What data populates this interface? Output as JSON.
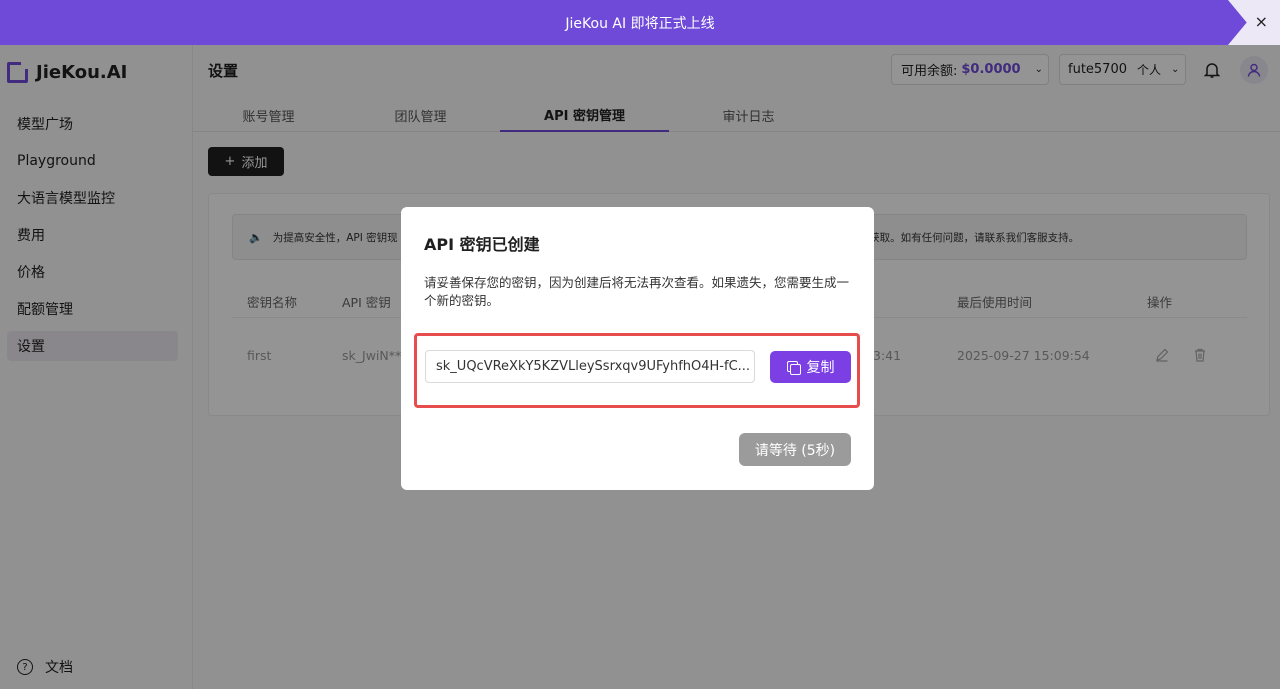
{
  "banner": {
    "text": "JieKou AI 即将正式上线",
    "close_label": "×"
  },
  "brand": {
    "name": "JieKou.AI",
    "accent": "#6f4ad9"
  },
  "sidebar": {
    "items": [
      {
        "label": "模型广场"
      },
      {
        "label": "Playground"
      },
      {
        "label": "大语言模型监控"
      },
      {
        "label": "费用"
      },
      {
        "label": "价格"
      },
      {
        "label": "配额管理"
      },
      {
        "label": "设置",
        "active": true
      }
    ],
    "docs_label": "文档"
  },
  "header": {
    "title": "设置",
    "balance_label": "可用余额:",
    "balance_value": "$0.0000",
    "username": "fute5700",
    "account_type": "个人"
  },
  "tabs": [
    {
      "label": "账号管理"
    },
    {
      "label": "团队管理"
    },
    {
      "label": "API 密钥管理",
      "active": true
    },
    {
      "label": "审计日志"
    }
  ],
  "toolbar": {
    "add_label": "添加"
  },
  "notice": {
    "text_left": "为提高安全性，API 密钥现",
    "text_right": "法再次获取。如有任何问题，请联系我们客服支持。"
  },
  "table": {
    "headers": [
      "密钥名称",
      "API 密钥",
      "最后使用时间",
      "操作"
    ],
    "rows": [
      {
        "name": "first",
        "key": "sk_JwiN**",
        "created_tail": "3:41",
        "last_used": "2025-09-27 15:09:54"
      }
    ]
  },
  "modal": {
    "title": "API 密钥已创建",
    "description": "请妥善保存您的密钥，因为创建后将无法再次查看。如果遗失，您需要生成一个新的密钥。",
    "key_value": "sk_UQcVReXkY5KZVLleySsrxqv9UFyhfhO4H-fC...",
    "copy_label": "复制",
    "wait_label": "请等待 (5秒)"
  }
}
